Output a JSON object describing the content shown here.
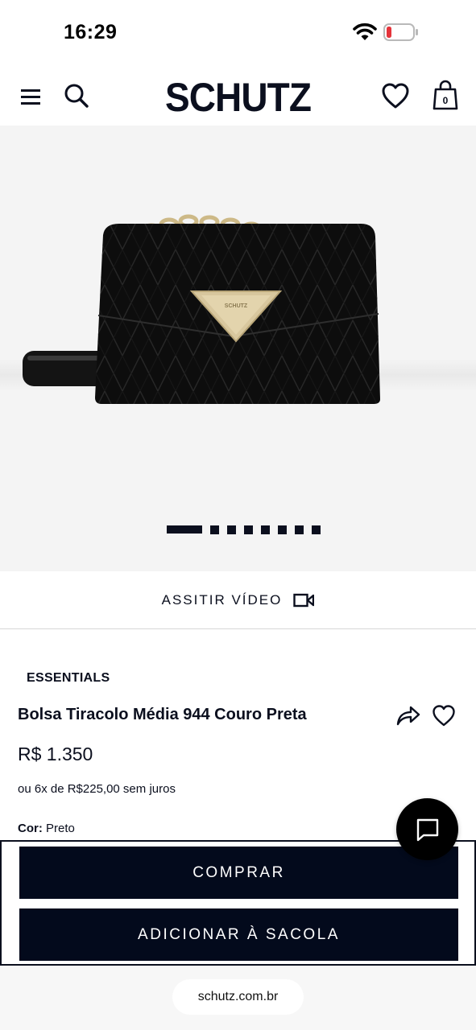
{
  "status_bar": {
    "time": "16:29"
  },
  "header": {
    "logo": "SCHUTZ",
    "bag_count": "0"
  },
  "gallery": {
    "total_slides": 8,
    "active_slide": 1
  },
  "video": {
    "label": "ASSITIR VÍDEO"
  },
  "product": {
    "collection": "ESSENTIALS",
    "name": "Bolsa Tiracolo Média 944 Couro Preta",
    "price": "R$ 1.350",
    "installments": "ou 6x de R$225,00 sem juros",
    "color_label": "Cor:",
    "color_value": " Preto",
    "bag_logo": "SCHUTZ"
  },
  "actions": {
    "buy": "COMPRAR",
    "add_to_bag": "ADICIONAR À SACOLA"
  },
  "browser": {
    "url": "schutz.com.br"
  },
  "colors": {
    "brand_navy": "#030a1c",
    "battery_low": "#e5343b",
    "image_bg": "#f4f4f4"
  }
}
